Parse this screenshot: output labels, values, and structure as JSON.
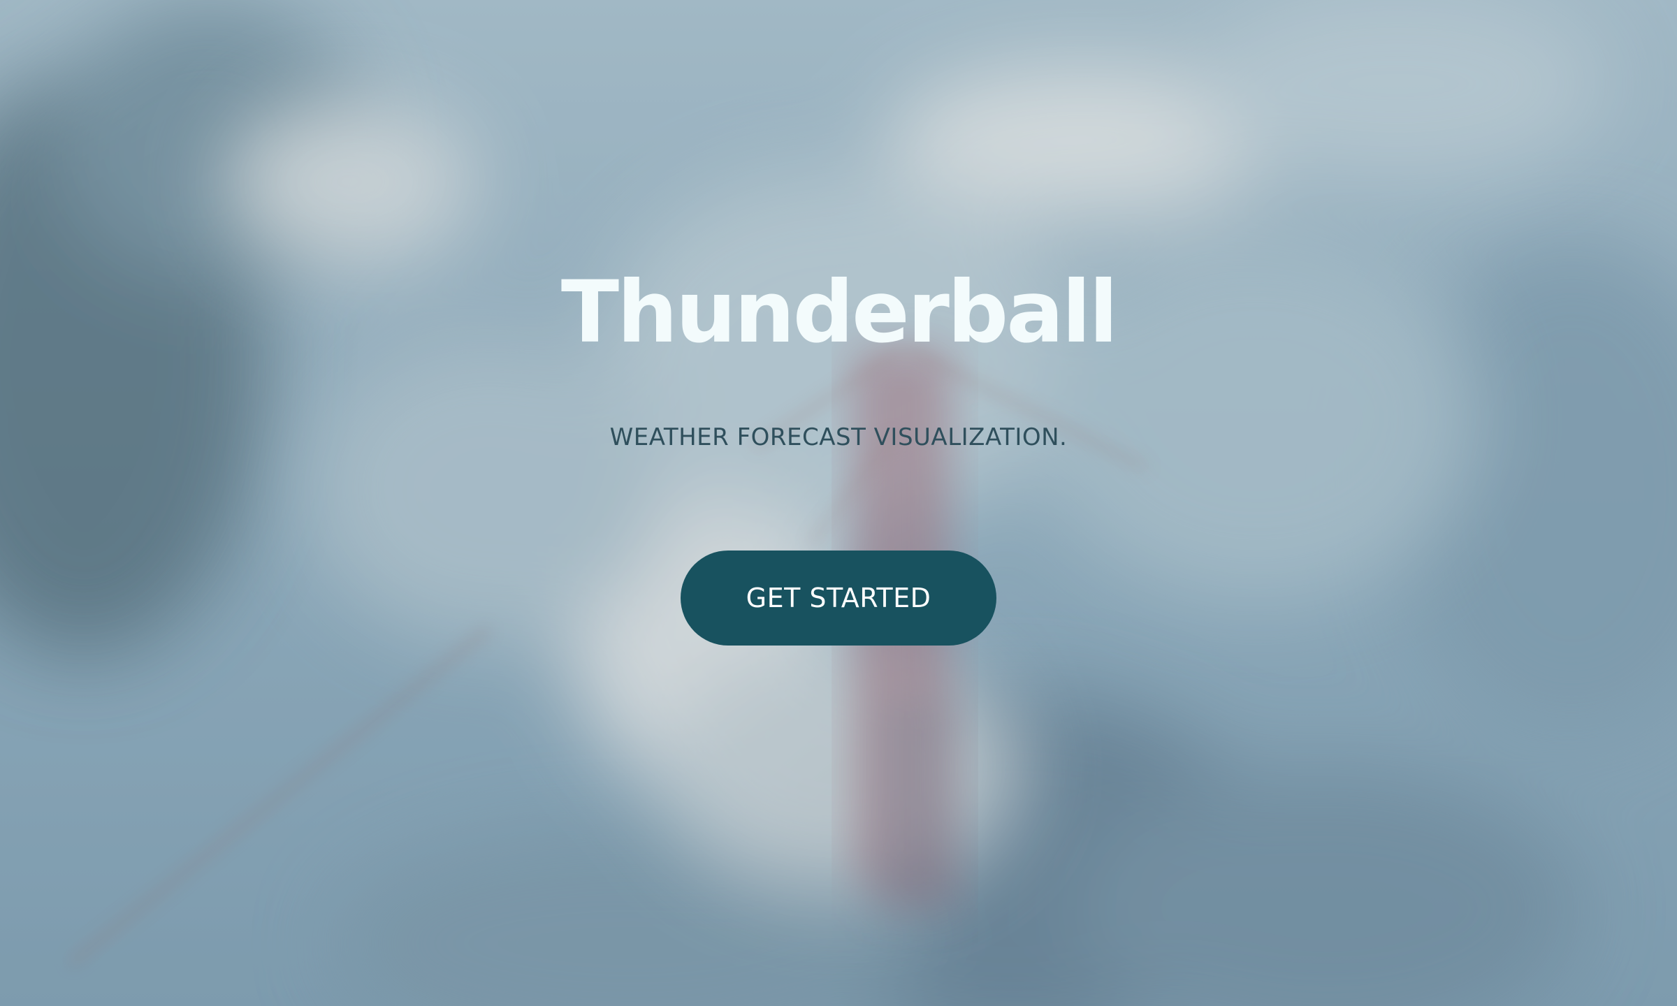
{
  "hero": {
    "title": "Thunderball",
    "subtitle": "WEATHER FORECAST VISUALIZATION.",
    "cta_label": "GET STARTED",
    "background_image": "foggy-sky-aerial-bridge",
    "colors": {
      "title": "#f3fbfc",
      "subtitle": "#2f4f5c",
      "button_bg": "#18525f",
      "button_text": "#ffffff"
    }
  }
}
